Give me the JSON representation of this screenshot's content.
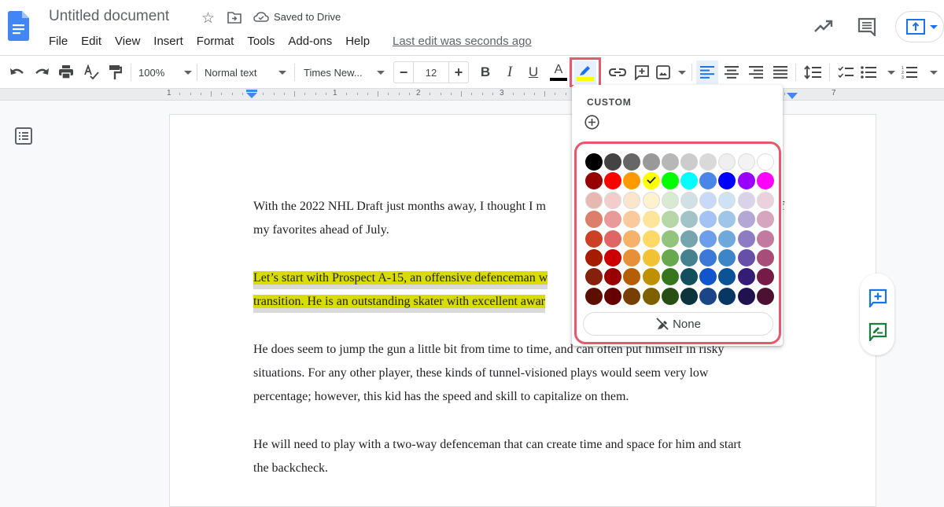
{
  "app": {
    "doc_title": "Untitled document",
    "save_status": "Saved to Drive",
    "last_edit": "Last edit was seconds ago"
  },
  "menu": [
    "File",
    "Edit",
    "View",
    "Insert",
    "Format",
    "Tools",
    "Add-ons",
    "Help"
  ],
  "toolbar": {
    "zoom": "100%",
    "style": "Normal text",
    "font": "Times New...",
    "font_size": "12",
    "text_color": "#000000",
    "highlight_color": "#ffff00",
    "accent": "#1a73e8"
  },
  "ruler": {
    "labels": [
      "1",
      "1",
      "2",
      "3",
      "7"
    ]
  },
  "highlight_popup": {
    "custom_label": "CUSTOM",
    "none_label": "None",
    "selected": "#ffff00",
    "colors": [
      [
        "#000000",
        "#434343",
        "#666666",
        "#999999",
        "#b7b7b7",
        "#cccccc",
        "#d9d9d9",
        "#efefef",
        "#f3f3f3",
        "#ffffff"
      ],
      [
        "#980000",
        "#ff0000",
        "#ff9900",
        "#ffff00",
        "#00ff00",
        "#00ffff",
        "#4a86e8",
        "#0000ff",
        "#9900ff",
        "#ff00ff"
      ],
      [
        "#e6b8af",
        "#f4cccc",
        "#fce5cd",
        "#fff2cc",
        "#d9ead3",
        "#d0e0e3",
        "#c9daf8",
        "#cfe2f3",
        "#d9d2e9",
        "#ead1dc"
      ],
      [
        "#dd7e6b",
        "#ea9999",
        "#f9cb9c",
        "#ffe599",
        "#b6d7a8",
        "#a2c4c9",
        "#a4c2f4",
        "#9fc5e8",
        "#b4a7d6",
        "#d5a6bd"
      ],
      [
        "#cc4125",
        "#e06666",
        "#f6b26b",
        "#ffd966",
        "#93c47d",
        "#76a5af",
        "#6d9eeb",
        "#6fa8dc",
        "#8e7cc3",
        "#c27ba0"
      ],
      [
        "#a61c00",
        "#cc0000",
        "#e69138",
        "#f1c232",
        "#6aa84f",
        "#45818e",
        "#3c78d8",
        "#3d85c6",
        "#674ea7",
        "#a64d79"
      ],
      [
        "#85200c",
        "#990000",
        "#b45f06",
        "#bf9000",
        "#38761d",
        "#134f5c",
        "#1155cc",
        "#0b5394",
        "#351c75",
        "#741b47"
      ],
      [
        "#5b0f00",
        "#660000",
        "#783f04",
        "#7f6000",
        "#274e13",
        "#0c343d",
        "#1c4587",
        "#073763",
        "#20124d",
        "#4c1130"
      ]
    ]
  },
  "document": {
    "paragraphs": [
      {
        "lines": [
          "With the 2022 NHL Draft just months away, I thought I m",
          "my favorites ahead of July."
        ],
        "highlighted": false
      },
      {
        "lines": [
          "Let’s start with Prospect A-15, an offensive defenceman w",
          "transition. He is an outstanding skater with excellent awar"
        ],
        "highlighted": true,
        "highlight_color": "#d8dc00"
      },
      {
        "lines": [
          "He does seem to jump the gun a little bit from time to time, and can often put himself in risky",
          "situations. For any other player, these kinds of tunnel-visioned plays would seem very low",
          "percentage; however, this kid has the speed and skill to capitalize on them."
        ],
        "highlighted": false
      },
      {
        "lines": [
          "He will need to play with a two-way defenceman that can create time and space for him and start",
          "the backcheck."
        ],
        "highlighted": false
      }
    ],
    "trailing_char_line1": "f"
  }
}
